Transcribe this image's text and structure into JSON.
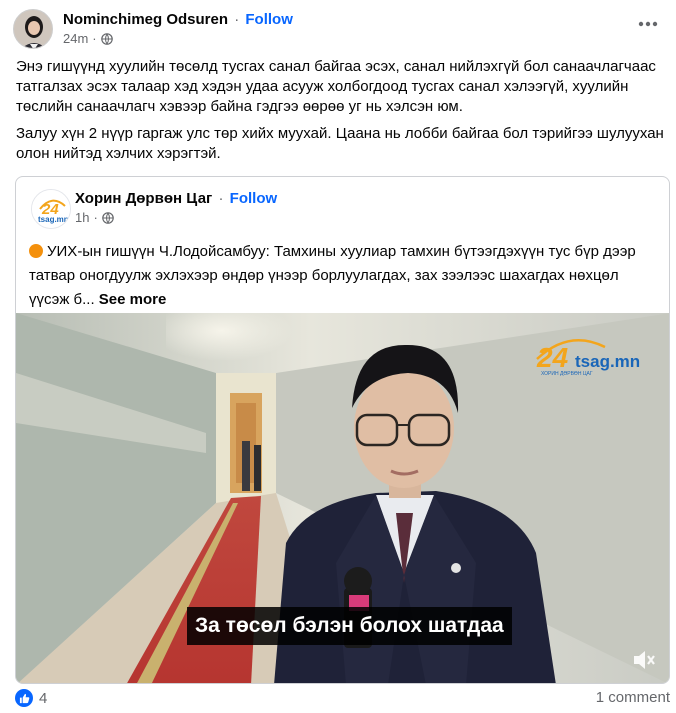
{
  "post": {
    "author": "Nominchimeg Odsuren",
    "separator": "·",
    "follow_label": "Follow",
    "time": "24m",
    "paragraph_1": "Энэ гишүүнд хуулийн төсөлд тусгах санал байгаа эсэх, санал нийлэхгүй бол санаачлагчаас татгалзах эсэх талаар хэд хэдэн удаа асууж холбогдоод тусгах санал хэлээгүй, хуулийн төслийн санаачлагч хэвээр байна гэдгээ өөрөө уг нь хэлсэн юм.",
    "paragraph_2": "Залуу хүн 2 нүүр гаргаж улс төр хийх муухай. Цаана нь лобби байгаа бол тэрийгээ шулуухан олон нийтэд хэлчих хэрэгтэй."
  },
  "shared": {
    "author": "Хорин Дөрвөн Цаг",
    "follow_label": "Follow",
    "time": "1h",
    "text": "УИХ-ын гишүүн Ч.Лодойсамбуу: Тамхины хуулиар тамхин  бүтээгдэхүүн тус бүр дээр татвар оногдуулж эхлэхээр өндөр үнээр борлуулагдах, зах зээлээс шахагдах нөхцөл үүсэж б...",
    "see_more": "See more",
    "avatar_logo_text": "24",
    "avatar_logo_sub": "tsag.mn",
    "video": {
      "subtitle": "За төсөл бэлэн болох шатдаа",
      "watermark_number": "24",
      "watermark_text": "tsag.mn",
      "watermark_tagline": "ХОРИН ДӨРВӨН ЦАГ"
    }
  },
  "footer": {
    "reaction_count": "4",
    "comments": "1 comment"
  },
  "icons": {
    "more": "more-horizontal-icon",
    "globe": "globe-icon",
    "like": "like-thumb-icon",
    "mute": "volume-muted-icon"
  },
  "colors": {
    "accent": "#0866ff",
    "secondary_text": "#65676b",
    "orange": "#f4900c",
    "tsag_orange": "#f3a51c"
  }
}
